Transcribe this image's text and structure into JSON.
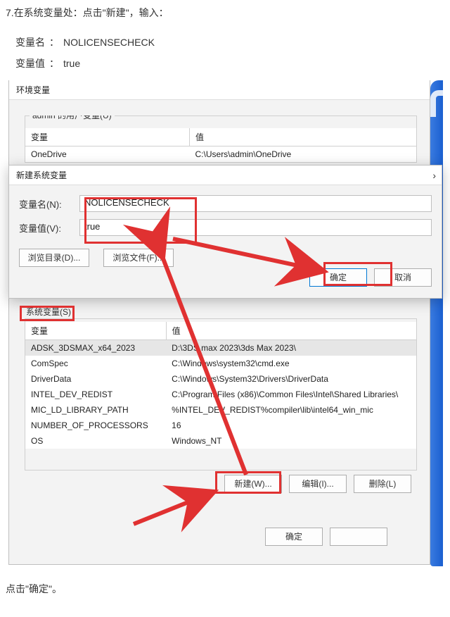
{
  "step_text": "7.在系统变量处：点击\"新建\"，输入：",
  "var_name_label": "变量名",
  "var_name_value": "NOLICENSECHECK",
  "var_value_label": "变量值",
  "var_value_value": "true",
  "footer_text": "点击\"确定\"。",
  "env_dlg": {
    "title": "环境变量",
    "user_section_legend": "admin 的用户变量(U)",
    "user_table": {
      "col_var": "变量",
      "col_val": "值",
      "rows": [
        {
          "name": "OneDrive",
          "value": "C:\\Users\\admin\\OneDrive"
        }
      ]
    },
    "sys_label": "系统变量(S)",
    "sys_table": {
      "col_var": "变量",
      "col_val": "值",
      "rows": [
        {
          "name": "ADSK_3DSMAX_x64_2023",
          "value": "D:\\3DS max 2023\\3ds Max 2023\\"
        },
        {
          "name": "ComSpec",
          "value": "C:\\Windows\\system32\\cmd.exe"
        },
        {
          "name": "DriverData",
          "value": "C:\\Windows\\System32\\Drivers\\DriverData"
        },
        {
          "name": "INTEL_DEV_REDIST",
          "value": "C:\\Program Files (x86)\\Common Files\\Intel\\Shared Libraries\\"
        },
        {
          "name": "MIC_LD_LIBRARY_PATH",
          "value": "%INTEL_DEV_REDIST%compiler\\lib\\intel64_win_mic"
        },
        {
          "name": "NUMBER_OF_PROCESSORS",
          "value": "16"
        },
        {
          "name": "OS",
          "value": "Windows_NT"
        }
      ]
    },
    "btn_new": "新建(W)...",
    "btn_edit": "编辑(I)...",
    "btn_delete": "删除(L)",
    "btn_ok": "确定",
    "btn_cancel_blur": ""
  },
  "new_dlg": {
    "title": "新建系统变量",
    "name_label": "变量名(N):",
    "name_value": "NOLICENSECHECK",
    "value_label": "变量值(V):",
    "value_value": "true",
    "btn_browse_dir": "浏览目录(D)...",
    "btn_browse_file": "浏览文件(F)...",
    "btn_ok": "确定",
    "btn_cancel": "取消"
  }
}
